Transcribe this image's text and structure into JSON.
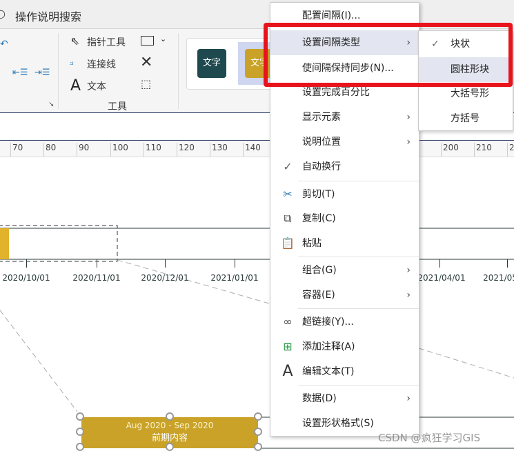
{
  "titlebar": {
    "search_label": "操作说明搜索"
  },
  "ribbon": {
    "tools": {
      "pointer": "指针工具",
      "connector": "连接线",
      "text": "文本",
      "group_label": "工具"
    },
    "styles": [
      {
        "label": "文字",
        "color": "#1e4a4f"
      },
      {
        "label": "文字",
        "color": "#c9a227"
      }
    ]
  },
  "ruler": {
    "left": [
      "70",
      "80",
      "90",
      "100",
      "110",
      "120",
      "130",
      "140"
    ],
    "right": [
      "200",
      "210",
      "2"
    ]
  },
  "timeline": {
    "dates_left": [
      "2020/10/01",
      "2020/11/01",
      "2020/12/01",
      "2021/01/01"
    ],
    "dates_right": [
      "2021/04/01",
      "2021/05"
    ]
  },
  "interval_block": {
    "range": "Aug 2020 - Sep 2020",
    "label": "前期内容",
    "color": "#c9a227"
  },
  "context_menu": {
    "items": [
      {
        "label": "配置间隔(I)..."
      },
      {
        "label": "设置间隔类型",
        "submenu": true,
        "highlighted": true
      },
      {
        "label": "使间隔保持同步(N)..."
      },
      {
        "label": "设置完成百分比"
      },
      {
        "label": "显示元素",
        "submenu": true
      },
      {
        "label": "说明位置",
        "submenu": true
      },
      {
        "label": "自动换行",
        "checked": true
      },
      {
        "label": "剪切(T)",
        "icon": "scissors-icon"
      },
      {
        "label": "复制(C)",
        "icon": "copy-icon"
      },
      {
        "label": "粘贴",
        "icon": "paste-icon"
      },
      {
        "label": "组合(G)",
        "submenu": true
      },
      {
        "label": "容器(E)",
        "submenu": true
      },
      {
        "label": "超链接(Y)...",
        "icon": "link-icon"
      },
      {
        "label": "添加注释(A)",
        "icon": "comment-icon"
      },
      {
        "label": "编辑文本(T)",
        "icon": "text-icon"
      },
      {
        "label": "数据(D)",
        "submenu": true
      },
      {
        "label": "设置形状格式(S)"
      }
    ]
  },
  "submenu": {
    "items": [
      {
        "label": "块状",
        "checked": true
      },
      {
        "label": "圆柱形块",
        "highlighted": true
      },
      {
        "label": "大括号形"
      },
      {
        "label": "方括号"
      }
    ]
  },
  "watermark": "CSDN @疯狂学习GIS",
  "colors": {
    "highlight": "#e8141c",
    "menu_hover": "#e3e6f0"
  }
}
